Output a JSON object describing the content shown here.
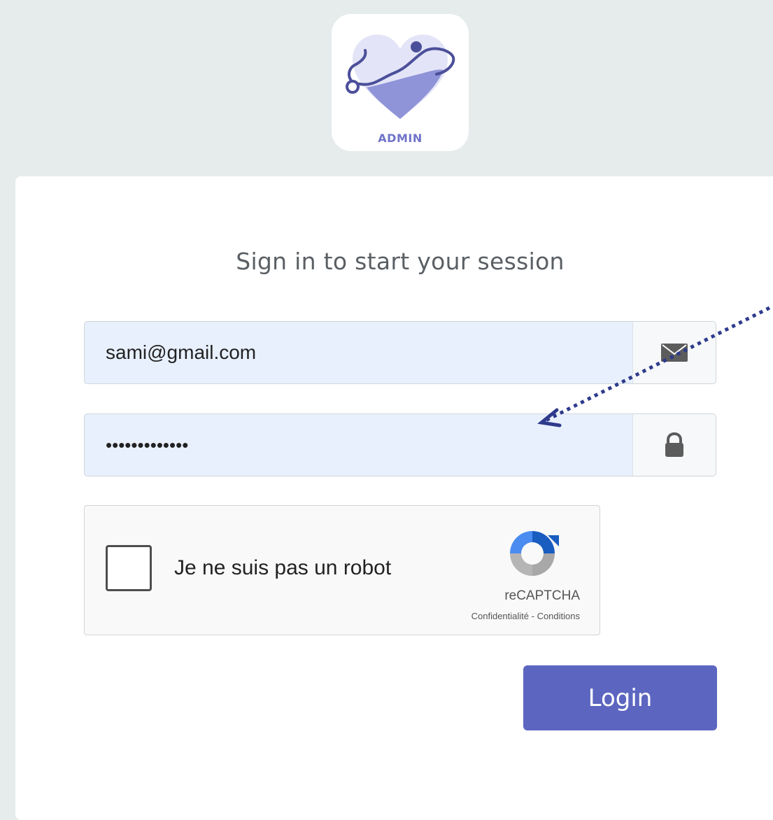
{
  "logo": {
    "label": "ADMIN",
    "accent": "#6f73c8"
  },
  "form": {
    "title": "Sign in to start your session",
    "email": {
      "value": "sami@gmail.com",
      "icon": "envelope-icon"
    },
    "password": {
      "value": "•••••••••••••",
      "icon": "lock-icon"
    },
    "captcha": {
      "label": "Je ne suis pas un robot",
      "brand": "reCAPTCHA",
      "links": "Confidentialité - Conditions",
      "checked": false
    },
    "login_label": "Login"
  },
  "colors": {
    "page_bg": "#e6ebec",
    "input_bg": "#e8f0fe",
    "button": "#5c66c0",
    "annotation": "#2e3a8c"
  }
}
